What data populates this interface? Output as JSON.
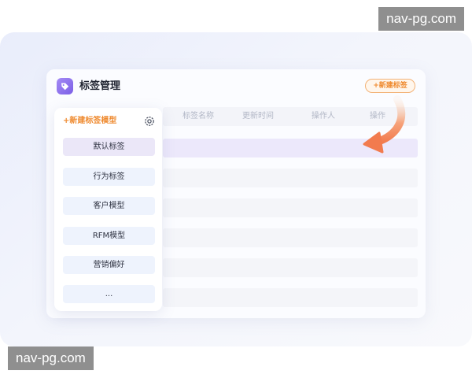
{
  "watermark": {
    "top": "nav-pg.com",
    "bottom": "nav-pg.com"
  },
  "card": {
    "title": "标签管理",
    "new_tag_button": "+新建标签"
  },
  "table": {
    "columns": [
      "标签名称",
      "更新时间",
      "操作人",
      "操作"
    ],
    "row_count": 6,
    "active_row": 0
  },
  "sidebar": {
    "new_model_label": "+新建标签模型",
    "settings_icon": "gear-icon",
    "items": [
      {
        "label": "默认标签",
        "active": true
      },
      {
        "label": "行为标签",
        "active": false
      },
      {
        "label": "客户模型",
        "active": false
      },
      {
        "label": "RFM模型",
        "active": false
      },
      {
        "label": "营销偏好",
        "active": false
      },
      {
        "label": "...",
        "active": false
      }
    ]
  },
  "colors": {
    "accent_orange": "#ef8a2f",
    "accent_purple": "#7b5fe6",
    "arrow_start": "#fbe3cf",
    "arrow_end": "#f27b4e"
  }
}
